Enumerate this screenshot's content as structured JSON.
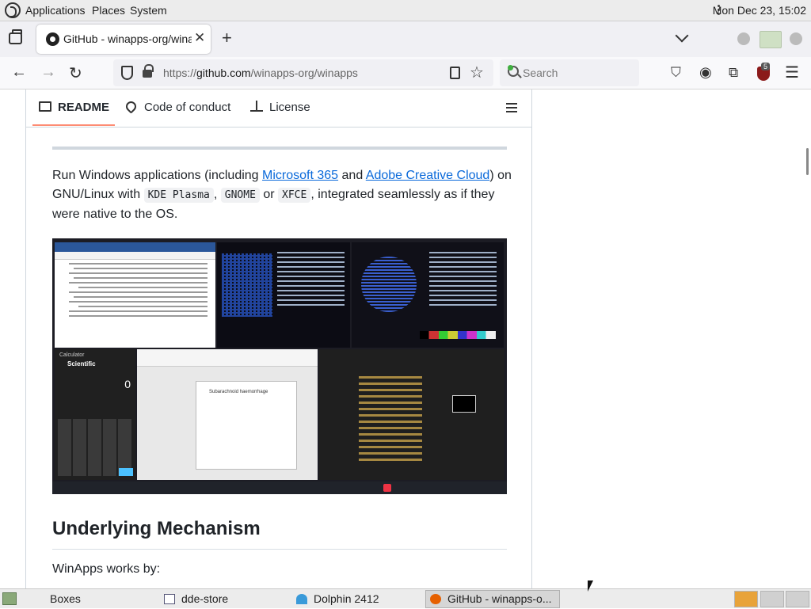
{
  "system_panel": {
    "menus": [
      "Applications",
      "Places",
      "System"
    ],
    "clock": "Mon Dec 23, 15:02"
  },
  "browser": {
    "tab_title": "GitHub - winapps-org/winapps",
    "new_tab_label": "+",
    "close_label": "✕",
    "url_prefix": "https://",
    "url_host": "github.com",
    "url_path": "/winapps-org/winapps",
    "search_placeholder": "Search",
    "ublock_badge": "5"
  },
  "readme": {
    "tabs": [
      "README",
      "Code of conduct",
      "License"
    ],
    "intro": {
      "part1": "Run Windows applications (including ",
      "link1": "Microsoft 365",
      "part2": " and ",
      "link2": "Adobe Creative Cloud",
      "part3": ") on GNU/Linux with ",
      "code1": "KDE Plasma",
      "part4": ", ",
      "code2": "GNOME",
      "part5": " or ",
      "code3": "XFCE",
      "part6": ", integrated seamlessly as if they were native to the OS."
    },
    "screenshot": {
      "calc_label": "Calculator",
      "calc_mode": "Scientific",
      "calc_display": "0",
      "slide_title": "Subarachnoid haemorrhage"
    },
    "heading": "Underlying Mechanism",
    "works_by": "WinApps works by:"
  },
  "taskbar": {
    "items": [
      "Boxes",
      "dde-store",
      "Dolphin 2412",
      "GitHub - winapps-o..."
    ]
  },
  "colors": {
    "link": "#0969da",
    "readme_underline": "#fd8c73",
    "ublock": "#8b1a1a"
  }
}
